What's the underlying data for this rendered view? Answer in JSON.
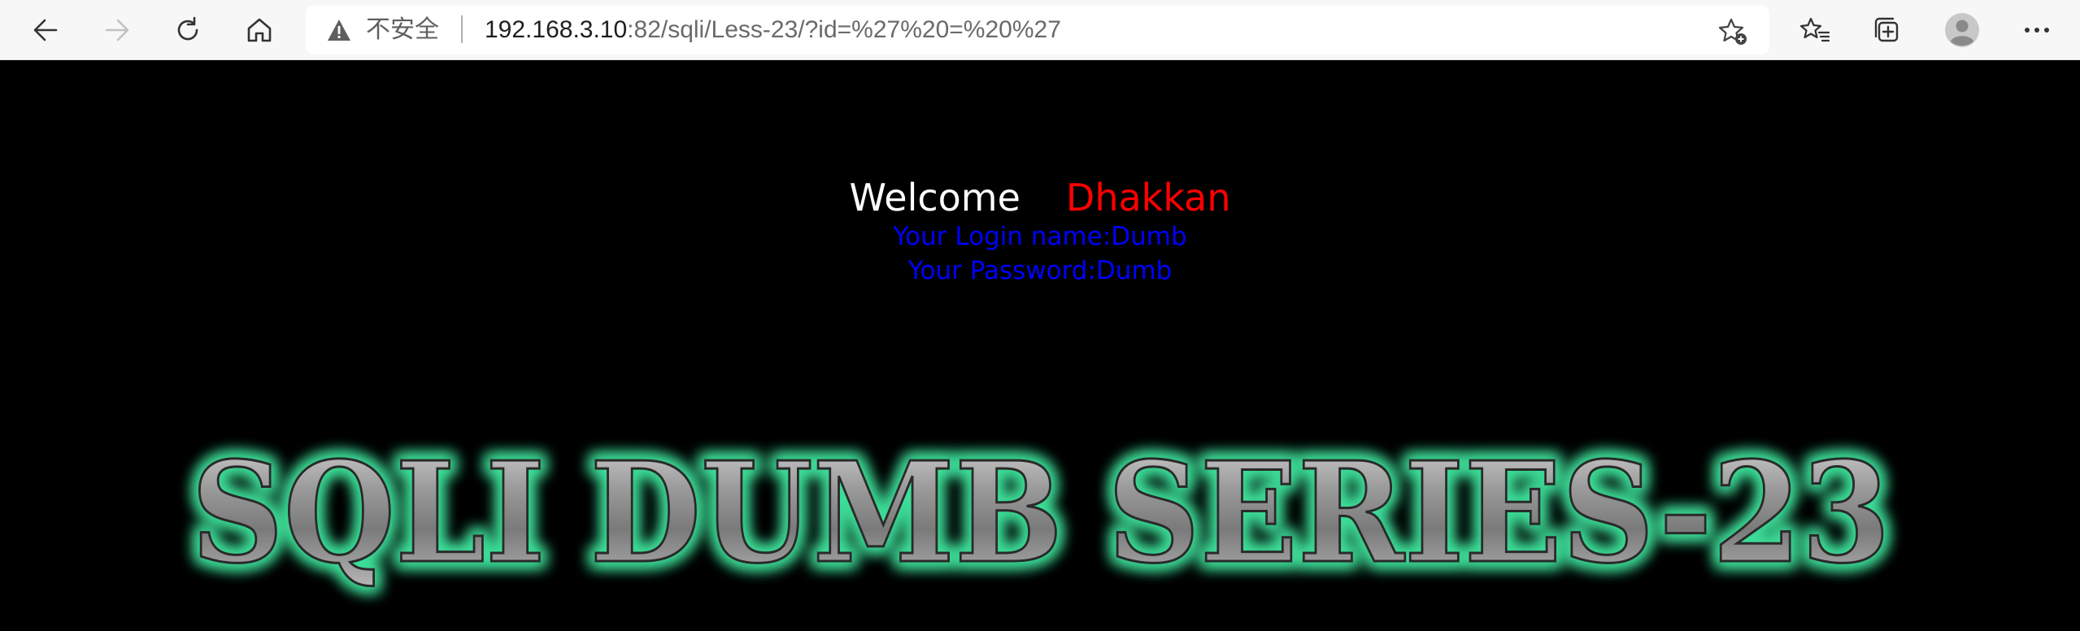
{
  "browser": {
    "security_label": "不安全",
    "url_host": "192.168.3.10",
    "url_rest": ":82/sqli/Less-23/?id=%27%20=%20%27",
    "icons": [
      "back-icon",
      "forward-icon",
      "refresh-icon",
      "home-icon",
      "warning-icon",
      "add-favorite-icon",
      "favorites-icon",
      "collections-icon",
      "profile-icon",
      "more-icon"
    ]
  },
  "page": {
    "welcome": "Welcome",
    "user": "Dhakkan",
    "login_name": "Your Login name:Dumb",
    "password": "Your Password:Dumb",
    "banner_title": "SQLI DUMB SERIES-23"
  },
  "colors": {
    "background": "#000000",
    "welcome": "#ffffff",
    "user": "#ff0000",
    "info": "#0000ff",
    "banner_glow": "#3ddc97"
  }
}
